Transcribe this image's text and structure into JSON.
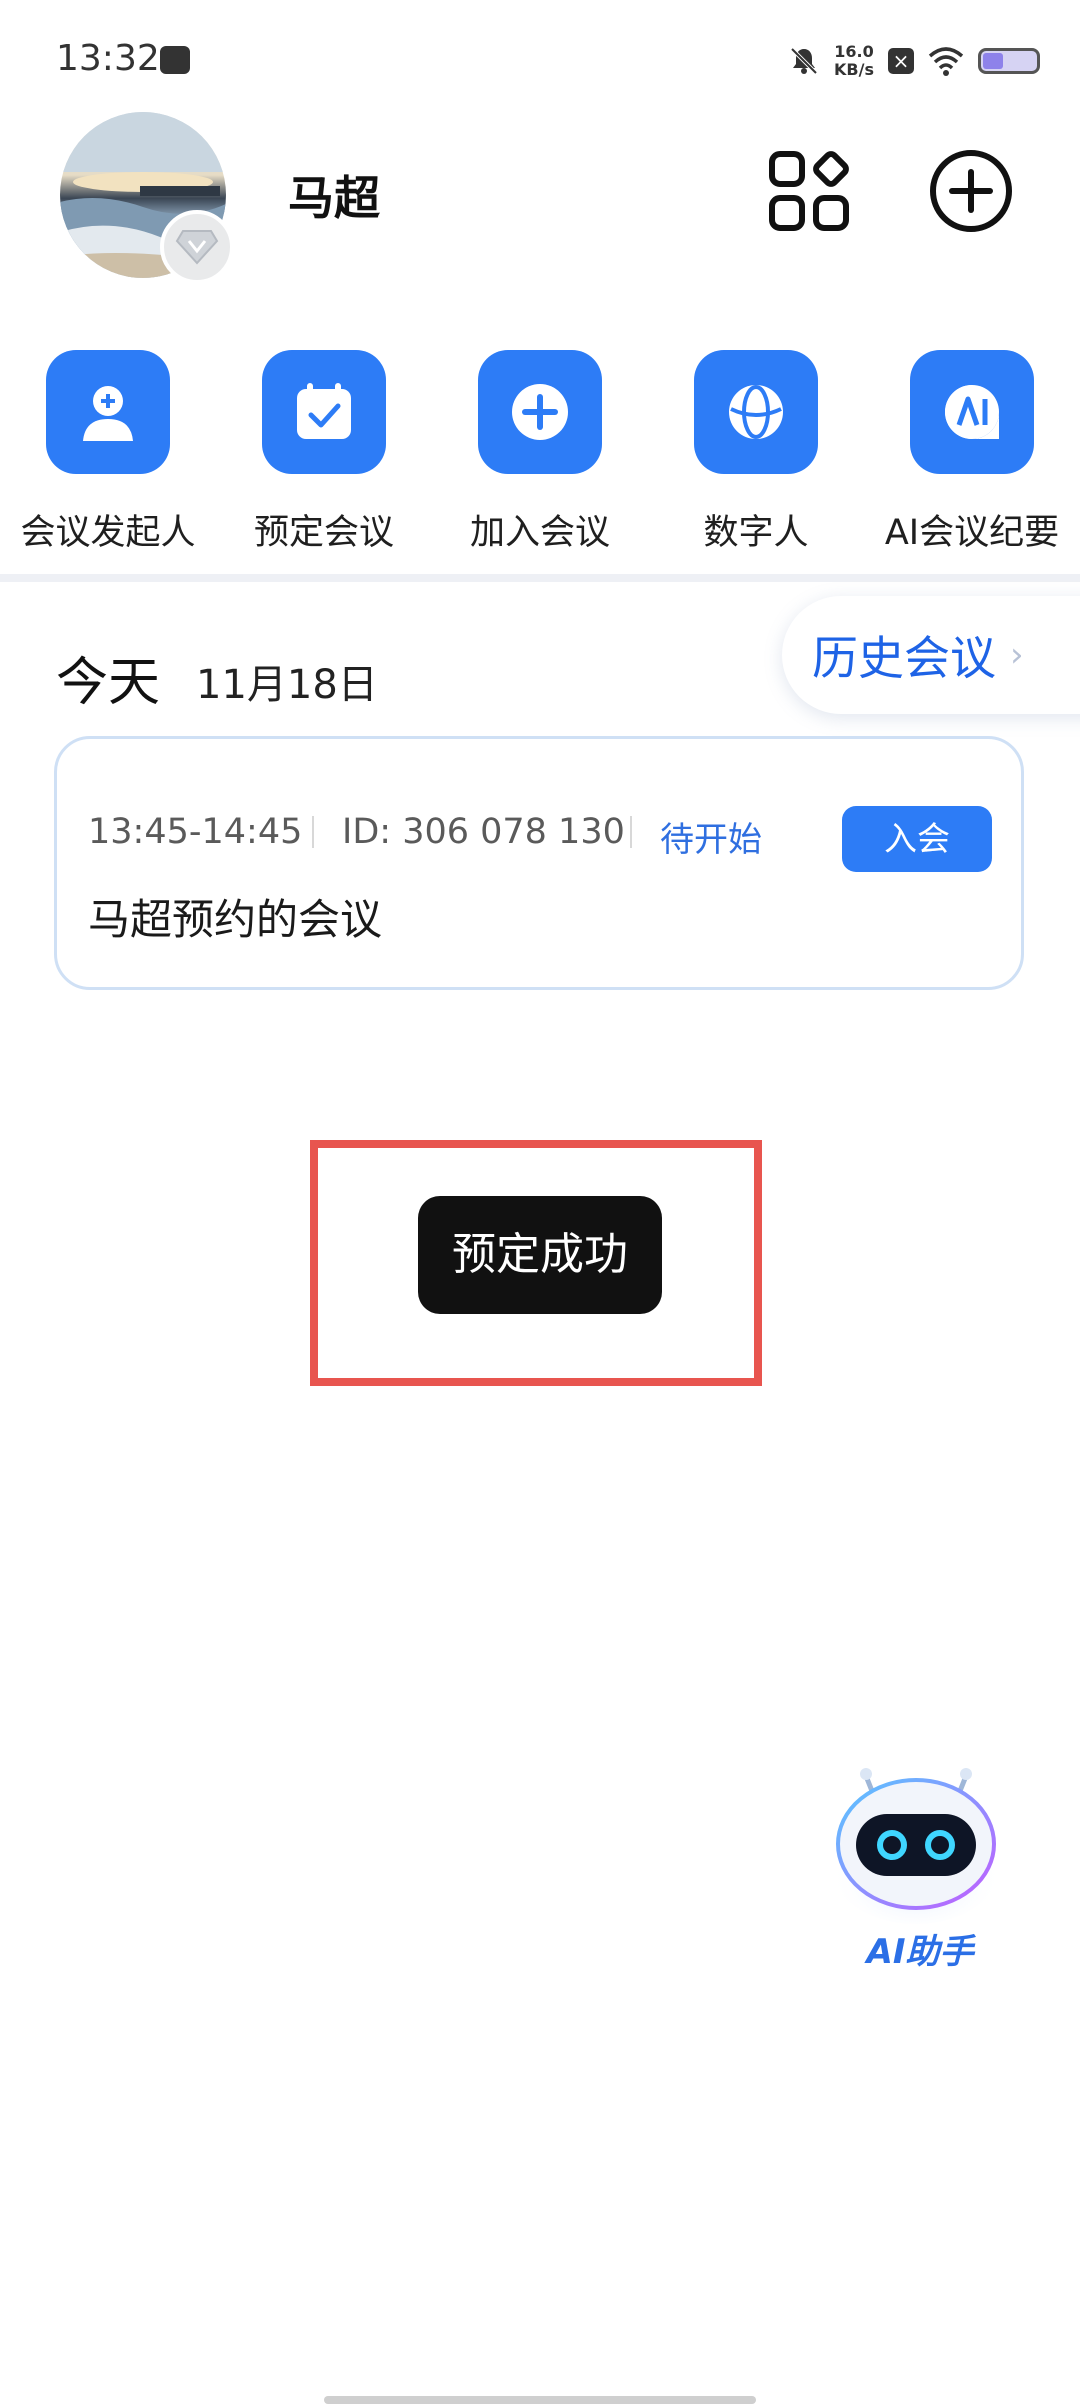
{
  "status_bar": {
    "time": "13:32",
    "network_speed_value": "16.0",
    "network_speed_unit": "KB/s"
  },
  "header": {
    "user_name": "马超"
  },
  "quick_actions": [
    {
      "label": "会议发起人",
      "icon": "user-plus-icon"
    },
    {
      "label": "预定会议",
      "icon": "calendar-check-icon"
    },
    {
      "label": "加入会议",
      "icon": "plus-circle-icon"
    },
    {
      "label": "数字人",
      "icon": "globe-icon"
    },
    {
      "label": "AI会议纪要",
      "icon": "ai-notes-icon"
    }
  ],
  "today": {
    "label": "今天",
    "date": "11月18日",
    "history_label": "历史会议"
  },
  "meeting": {
    "time": "13:45-14:45",
    "id": "ID: 306 078 130",
    "status": "待开始",
    "join_label": "入会",
    "title": "马超预约的会议"
  },
  "toast": {
    "message": "预定成功"
  },
  "assistant": {
    "label": "AI助手"
  },
  "colors": {
    "accent": "#2d7cf6",
    "link": "#1e63e6",
    "highlight_border": "#e8554f"
  }
}
